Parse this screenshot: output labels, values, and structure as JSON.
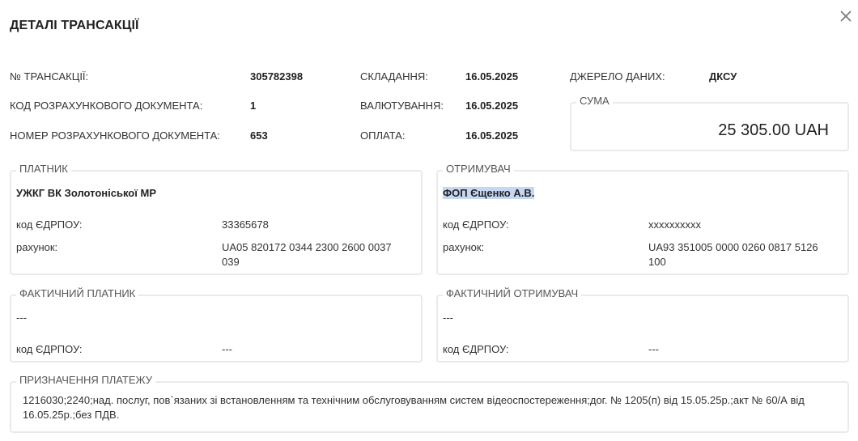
{
  "title": "ДЕТАЛІ ТРАНСАКЦІЇ",
  "close_icon": "close-icon",
  "info": {
    "transaction_no_label": "№ ТРАНСАКЦІЇ:",
    "transaction_no": "305782398",
    "doc_code_label": "КОД РОЗРАХУНКОВОГО ДОКУМЕНТА:",
    "doc_code": "1",
    "doc_number_label": "НОМЕР РОЗРАХУНКОВОГО ДОКУМЕНТА:",
    "doc_number": "653",
    "compiled_label": "СКЛАДАННЯ:",
    "compiled": "16.05.2025",
    "valuation_label": "ВАЛЮТУВАННЯ:",
    "valuation": "16.05.2025",
    "payment_label": "ОПЛАТА:",
    "payment": "16.05.2025",
    "source_label": "ДЖЕРЕЛО ДАНИХ:",
    "source": "ДКСУ"
  },
  "sum": {
    "legend": "СУМА",
    "value": "25 305.00 UAH"
  },
  "payer": {
    "legend": "ПЛАТНИК",
    "name": "УЖКГ ВК Золотоніської МР",
    "edrpou_label": "код ЄДРПОУ:",
    "edrpou": "33365678",
    "account_label": "рахунок:",
    "account": "UA05 820172 0344 2300 2600 0037 039"
  },
  "recipient": {
    "legend": "ОТРИМУВАЧ",
    "name": "ФОП Єщенко А.В.",
    "edrpou_label": "код ЄДРПОУ:",
    "edrpou": "xxxxxxxxxx",
    "account_label": "рахунок:",
    "account": "UA93 351005 0000 0260 0817 5126 100"
  },
  "actual_payer": {
    "legend": "ФАКТИЧНИЙ ПЛАТНИК",
    "name": "---",
    "edrpou_label": "код ЄДРПОУ:",
    "edrpou": "---"
  },
  "actual_recipient": {
    "legend": "ФАКТИЧНИЙ ОТРИМУВАЧ",
    "name": "---",
    "edrpou_label": "код ЄДРПОУ:",
    "edrpou": "---"
  },
  "purpose": {
    "legend": "ПРИЗНАЧЕННЯ ПЛАТЕЖУ",
    "text": "1216030;2240;над. послуг, пов`язаних зі встановленням та технічним обслуговуванням систем відеоспостереження;дог. № 1205(п) від 15.05.25р.;акт № 60/А від 16.05.25р.;без ПДВ."
  },
  "colors": {
    "border": "#e8eaed",
    "selection": "#c5d7f2"
  }
}
